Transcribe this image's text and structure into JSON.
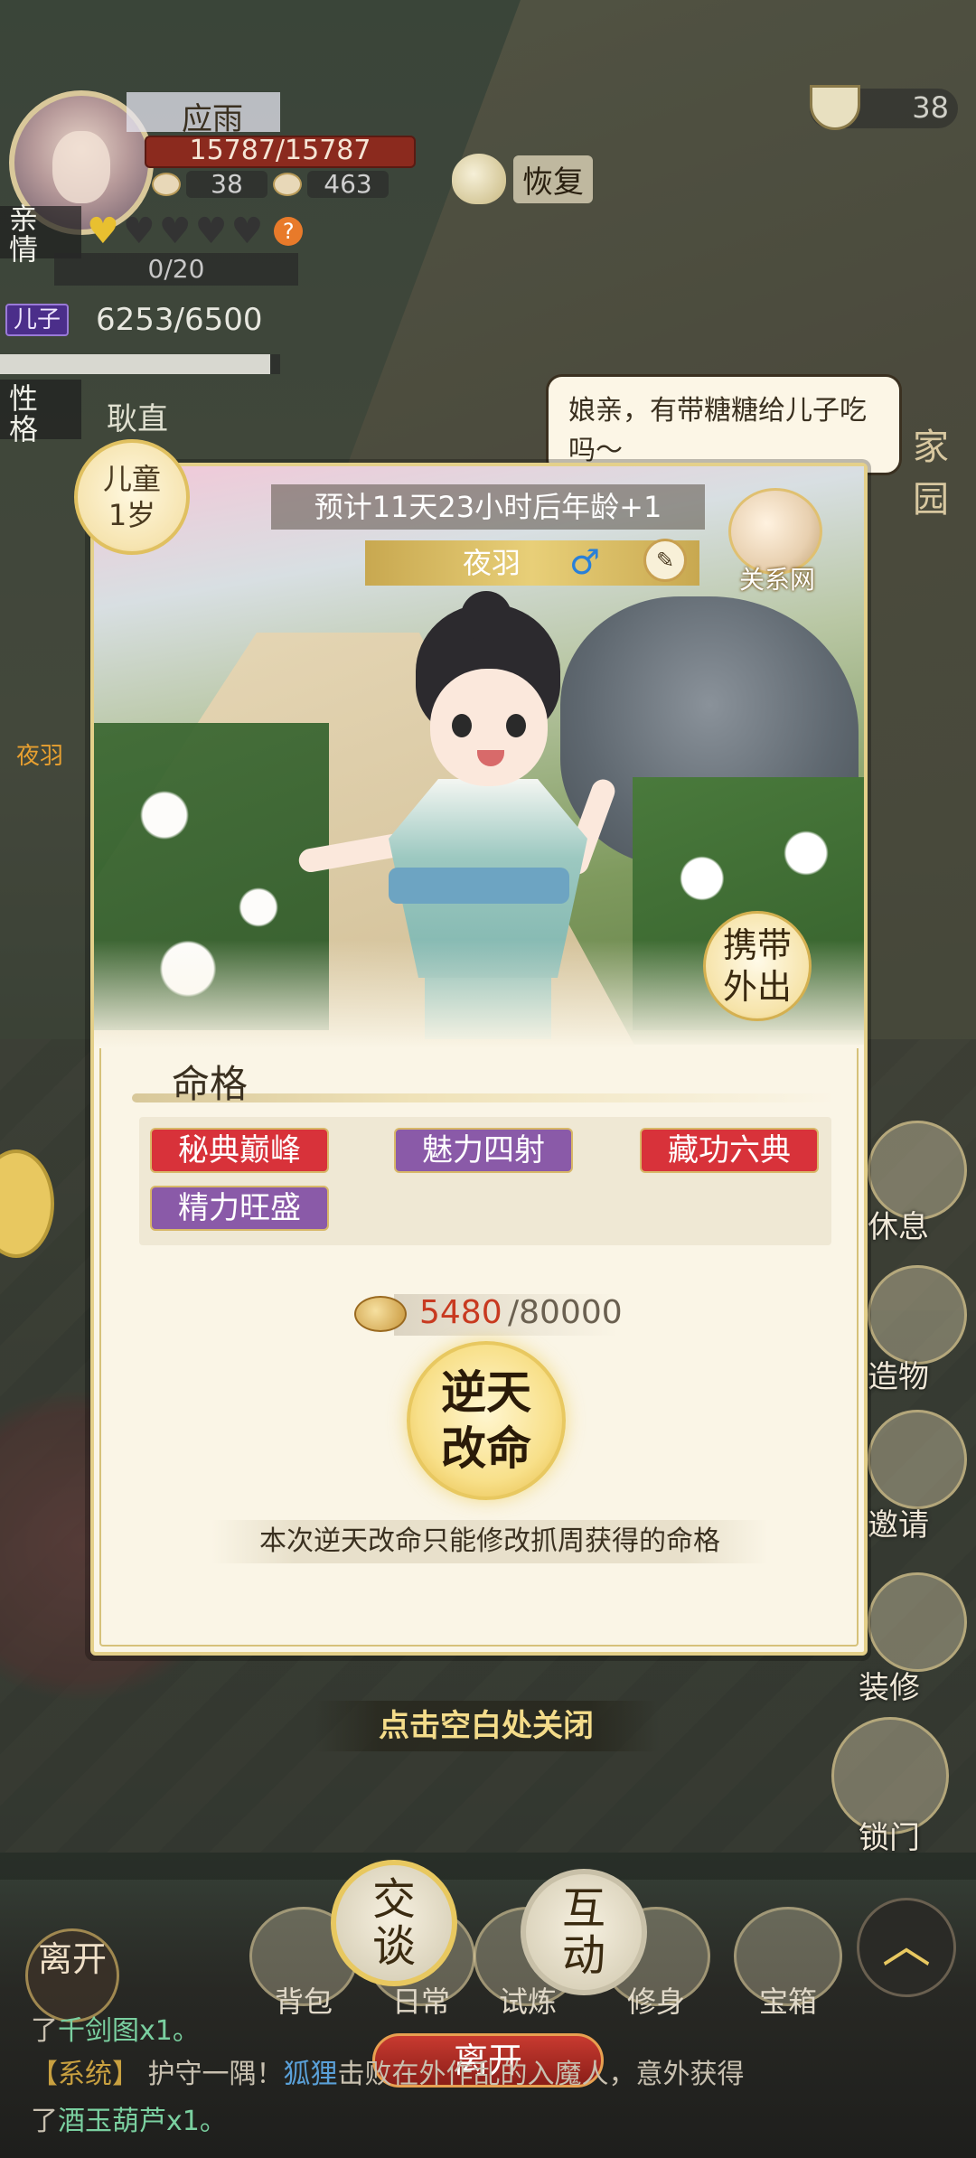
{
  "player": {
    "name": "应雨",
    "hp": "15787/15787",
    "bowl_count": "38",
    "bun_count": "463",
    "recover_label": "恢复"
  },
  "relation": {
    "qin_label": "亲\n情",
    "hearts_filled": 1,
    "hearts_total": 5,
    "qin_progress": "0/20",
    "son_tag": "儿子",
    "son_exp": "6253/6500",
    "son_exp_fraction": 0.963,
    "xingge_label": "性\n格",
    "xingge_value": "耿直"
  },
  "top_right": {
    "bowl_count": "38",
    "jiayuan": "家园"
  },
  "speech": "娘亲，有带糖糖给儿子吃吗～",
  "left_side": {
    "name": "夜羽"
  },
  "right_side": [
    {
      "label": "休息",
      "icon": "rest-icon"
    },
    {
      "label": "造物",
      "icon": "craft-icon"
    },
    {
      "label": "邀请",
      "icon": "invite-icon"
    },
    {
      "label": "装修",
      "icon": "hammer-icon"
    },
    {
      "label": "锁门",
      "icon": "lock-icon"
    }
  ],
  "panel": {
    "age_stage": "儿童",
    "age_years": "1岁",
    "timer": "预计11天23小时后年龄+1",
    "child_name": "夜羽",
    "gender_symbol": "♂",
    "relation_net": "关系网",
    "carry_out": [
      "携带",
      "外出"
    ],
    "mingge_title": "命格",
    "traits": [
      {
        "label": "秘典巅峰",
        "color": "red"
      },
      {
        "label": "魅力四射",
        "color": "purple"
      },
      {
        "label": "藏功六典",
        "color": "red"
      },
      {
        "label": "精力旺盛",
        "color": "purple"
      }
    ],
    "cost_current": "5480",
    "cost_max": "/80000",
    "reverse_button": [
      "逆天",
      "改命"
    ],
    "note": "本次逆天改命只能修改抓周获得的命格"
  },
  "close_hint": "点击空白处关闭",
  "bottom": {
    "leave_circle": "离开",
    "buttons": [
      {
        "label": "背包"
      },
      {
        "label": "日常"
      },
      {
        "label": "试炼"
      },
      {
        "label": "修身"
      },
      {
        "label": "宝箱"
      }
    ],
    "talk": [
      "交",
      "谈"
    ],
    "interact": [
      "互",
      "动"
    ],
    "leave_button": "离开",
    "expand_icon": "chevron-up-icon"
  },
  "log": {
    "line1_prefix": "了",
    "line1_item": "千剑图x1。",
    "line2_sys": "【系统】",
    "line2_text_a": "护守一隅！",
    "line2_name": "狐狸",
    "line2_text_b": "击败在外作乱的入魔人，意外获得",
    "line3_prefix": "了",
    "line3_item": "酒玉葫芦x1。"
  },
  "colors": {
    "panel_bg": "#faf5e6",
    "gold_border": "#e4d08a",
    "tag_red": "#d8323a",
    "tag_purple": "#8a5aa8",
    "cost_red": "#c83a20"
  }
}
